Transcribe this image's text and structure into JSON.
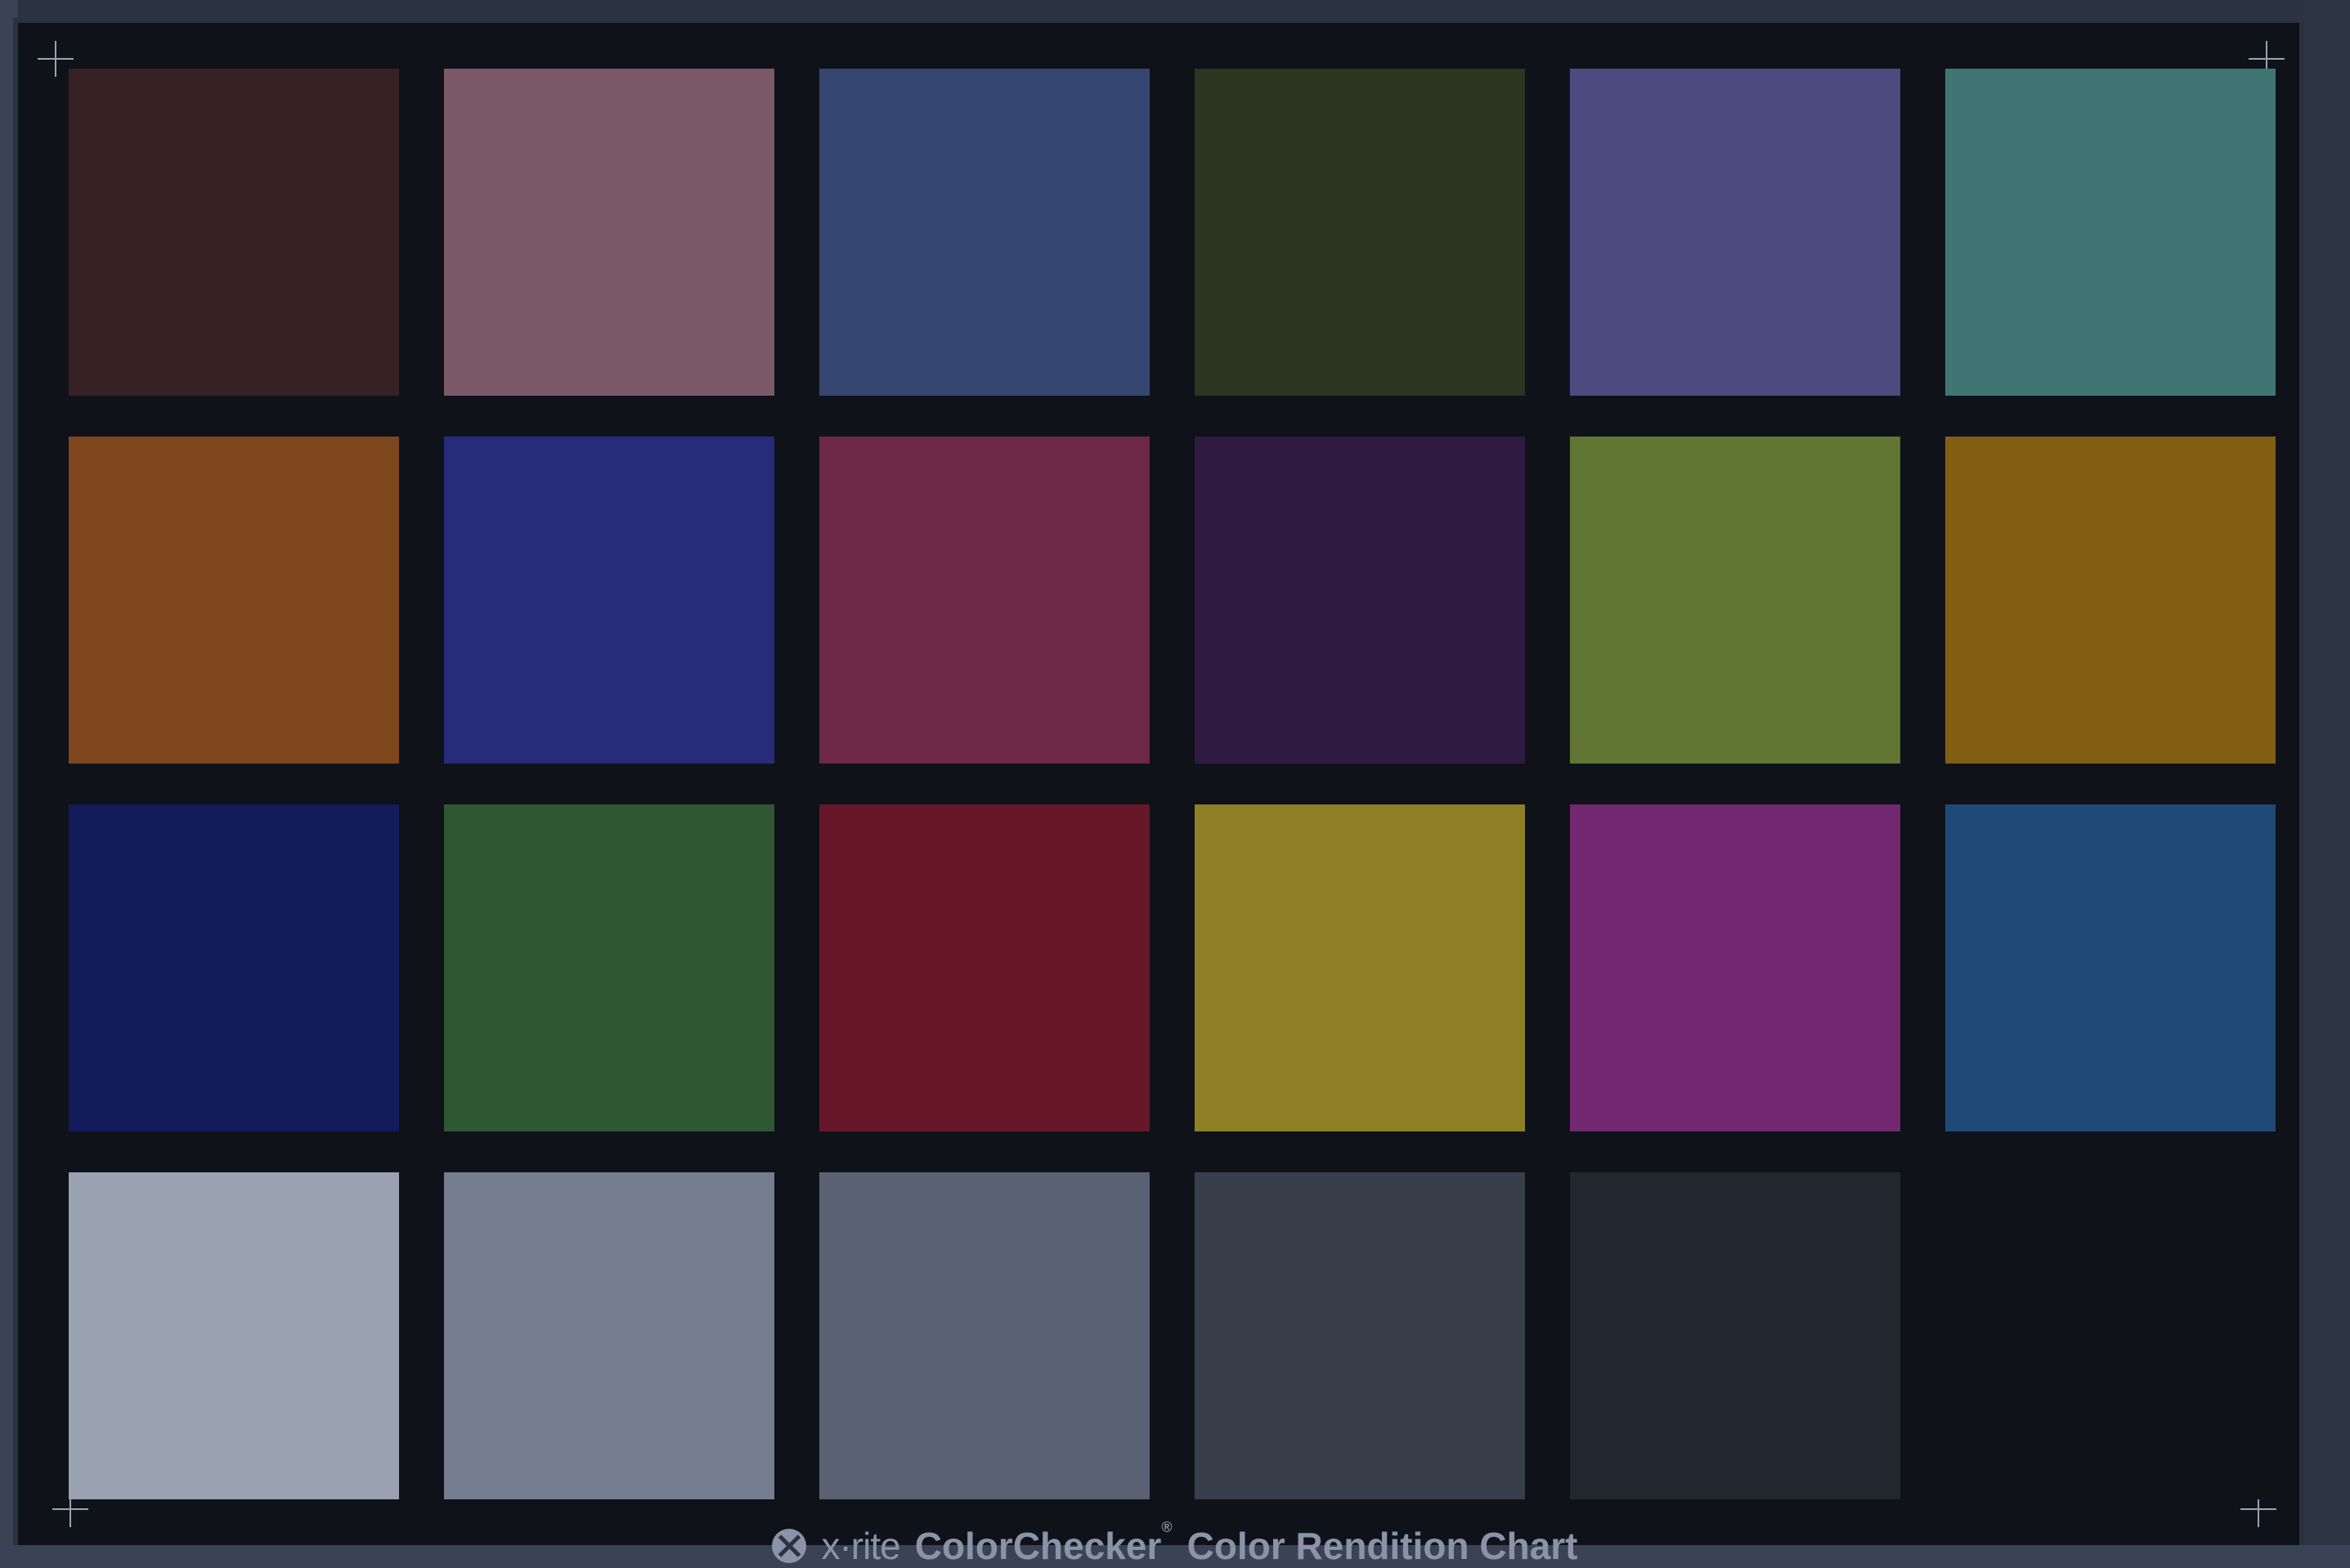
{
  "chart": {
    "brand": "x·rite",
    "product": "ColorChecker",
    "registered": "®",
    "subtitle": "Color Rendition Chart"
  },
  "patch_colors": [
    [
      "#362222",
      "#7b5968",
      "#34466f",
      "#2b3520",
      "#4c4a7f",
      "#3f7674"
    ],
    [
      "#7e461c",
      "#262c79",
      "#6c2844",
      "#2f1a42",
      "#607632",
      "#825e12"
    ],
    [
      "#121b5c",
      "#2f5732",
      "#661829",
      "#8e7f25",
      "#722870",
      "#1f4a77"
    ],
    [
      "#9aa1b0",
      "#757d90",
      "#5a6172",
      "#393e4b",
      "#22262e",
      "#101218"
    ]
  ]
}
